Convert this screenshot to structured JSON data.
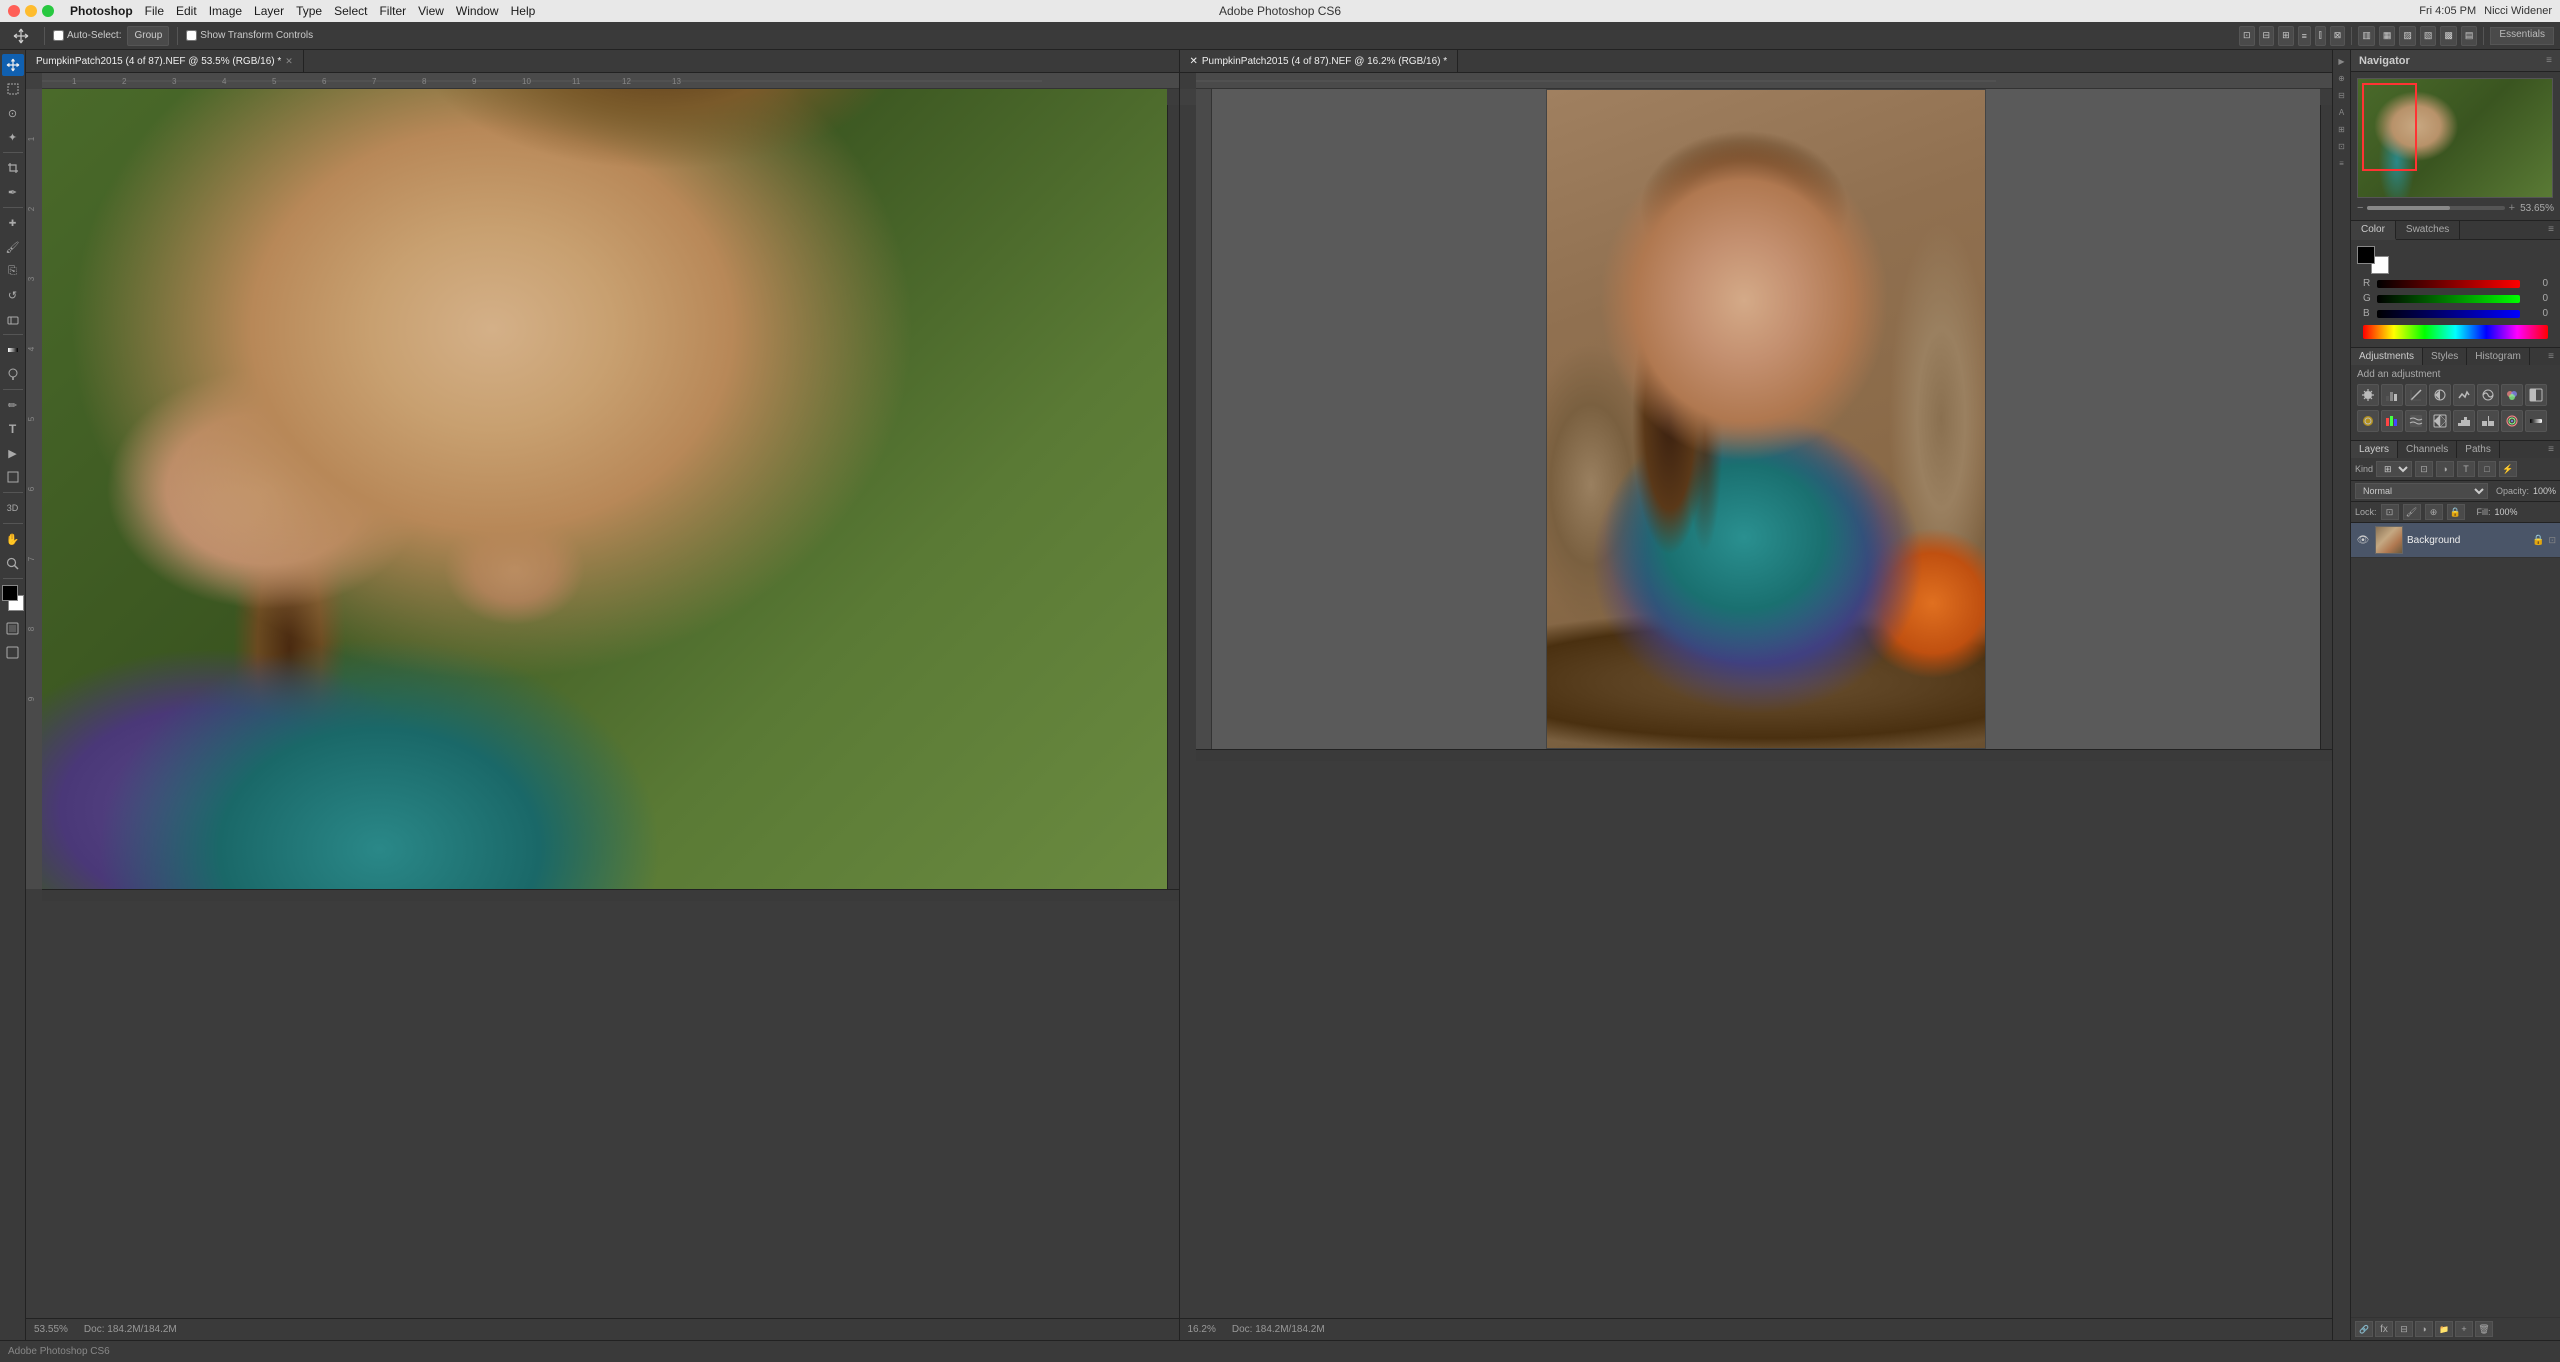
{
  "app": {
    "name": "Adobe Photoshop CS6",
    "title": "Adobe Photoshop CS6"
  },
  "menubar": {
    "app_name": "Photoshop",
    "menus": [
      "File",
      "Edit",
      "Image",
      "Layer",
      "Type",
      "Select",
      "Filter",
      "View",
      "Window",
      "Help"
    ],
    "select_label": "Select",
    "time": "Fri 4:05 PM",
    "user": "Nicci Widener"
  },
  "options_bar": {
    "tool_label": "Move",
    "auto_select_label": "Auto-Select:",
    "auto_select_type": "Group",
    "show_transform": "Show Transform Controls"
  },
  "left_doc": {
    "tab_label": "PumpkinPatch2015 (4 of 87).NEF @ 53.5% (RGB/16) *",
    "zoom": "53.55%",
    "doc_info": "Doc: 184.2M/184.2M"
  },
  "right_doc": {
    "tab_label": "PumpkinPatch2015 (4 of 87).NEF @ 16.2% (RGB/16) *",
    "zoom": "16.2%",
    "doc_info": "Doc: 184.2M/184.2M"
  },
  "navigator": {
    "title": "Navigator",
    "zoom_pct": "53.65%"
  },
  "color_panel": {
    "title": "Color",
    "tabs": [
      "Color",
      "Swatches"
    ],
    "active_tab": "Color",
    "r_label": "R",
    "g_label": "G",
    "b_label": "B",
    "r_value": "0",
    "g_value": "0",
    "b_value": "0"
  },
  "adjustments_panel": {
    "title": "Adjustments",
    "tabs": [
      "Adjustments",
      "Styles",
      "Histogram"
    ],
    "active_tab": "Adjustments",
    "add_label": "Add an adjustment",
    "icons": [
      "☀",
      "◑",
      "▣",
      "◈",
      "♦",
      "⊞",
      "⊟",
      "❯",
      "◒",
      "▤",
      "⊠",
      "≡",
      "⧉",
      "⬒",
      "⊞",
      "□"
    ]
  },
  "layers_panel": {
    "title": "Layers",
    "tabs": [
      "Layers",
      "Channels",
      "Paths"
    ],
    "active_tab": "Layers",
    "kind_label": "Kind",
    "blend_mode": "Normal",
    "opacity_label": "Opacity:",
    "opacity_value": "100%",
    "fill_label": "Fill:",
    "fill_value": "100%",
    "layers": [
      {
        "name": "Background",
        "visible": true,
        "locked": true
      }
    ]
  },
  "essentials": {
    "label": "Essentials"
  },
  "toolbar_tools": [
    {
      "name": "move",
      "icon": "↔",
      "label": "Move Tool"
    },
    {
      "name": "marquee",
      "icon": "▭",
      "label": "Marquee Tool"
    },
    {
      "name": "lasso",
      "icon": "⊙",
      "label": "Lasso Tool"
    },
    {
      "name": "quick-select",
      "icon": "✦",
      "label": "Quick Select"
    },
    {
      "name": "crop",
      "icon": "⊡",
      "label": "Crop Tool"
    },
    {
      "name": "eyedropper",
      "icon": "✒",
      "label": "Eyedropper"
    },
    {
      "name": "heal",
      "icon": "✚",
      "label": "Healing Brush"
    },
    {
      "name": "brush",
      "icon": "🖌",
      "label": "Brush Tool"
    },
    {
      "name": "clone",
      "icon": "⎘",
      "label": "Clone Stamp"
    },
    {
      "name": "history",
      "icon": "↺",
      "label": "History Brush"
    },
    {
      "name": "eraser",
      "icon": "◻",
      "label": "Eraser"
    },
    {
      "name": "gradient",
      "icon": "▤",
      "label": "Gradient Tool"
    },
    {
      "name": "dodge",
      "icon": "○",
      "label": "Dodge Tool"
    },
    {
      "name": "pen",
      "icon": "✏",
      "label": "Pen Tool"
    },
    {
      "name": "type",
      "icon": "T",
      "label": "Type Tool"
    },
    {
      "name": "path-select",
      "icon": "▷",
      "label": "Path Selection"
    },
    {
      "name": "shape",
      "icon": "□",
      "label": "Shape Tool"
    },
    {
      "name": "3d",
      "icon": "⬡",
      "label": "3D Tool"
    },
    {
      "name": "hand",
      "icon": "✋",
      "label": "Hand Tool"
    },
    {
      "name": "zoom",
      "icon": "⊕",
      "label": "Zoom Tool"
    }
  ]
}
